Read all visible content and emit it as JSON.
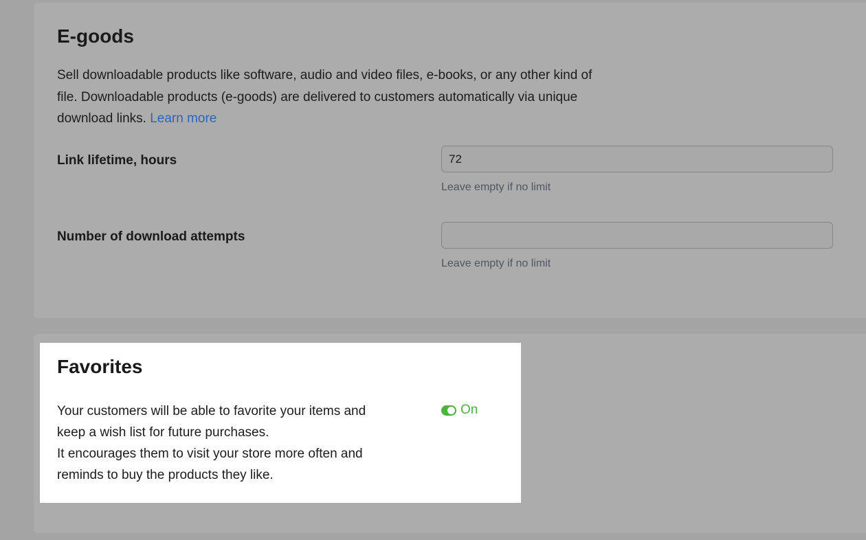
{
  "egoods": {
    "title": "E-goods",
    "description_line1": "Sell downloadable products like software, audio and video files, e-books, or any other kind of",
    "description_line2": "file. Downloadable products (e-goods) are delivered to customers automatically via unique",
    "description_line3": "download links.",
    "learn_more": "Learn more",
    "link_lifetime": {
      "label": "Link lifetime, hours",
      "value": "72",
      "hint": "Leave empty if no limit"
    },
    "download_attempts": {
      "label": "Number of download attempts",
      "value": "",
      "hint": "Leave empty if no limit"
    }
  },
  "favorites": {
    "title": "Favorites",
    "description_lines": [
      "Your customers will be able to favorite your items and",
      "keep a wish list for future purchases.",
      "It encourages them to visit your store more often and",
      "reminds to buy the products they like."
    ],
    "toggle": {
      "state_label": "On",
      "enabled": true,
      "color": "#4cb13e"
    }
  },
  "colors": {
    "link": "#2b66b8",
    "accent_green": "#4cb13e"
  }
}
